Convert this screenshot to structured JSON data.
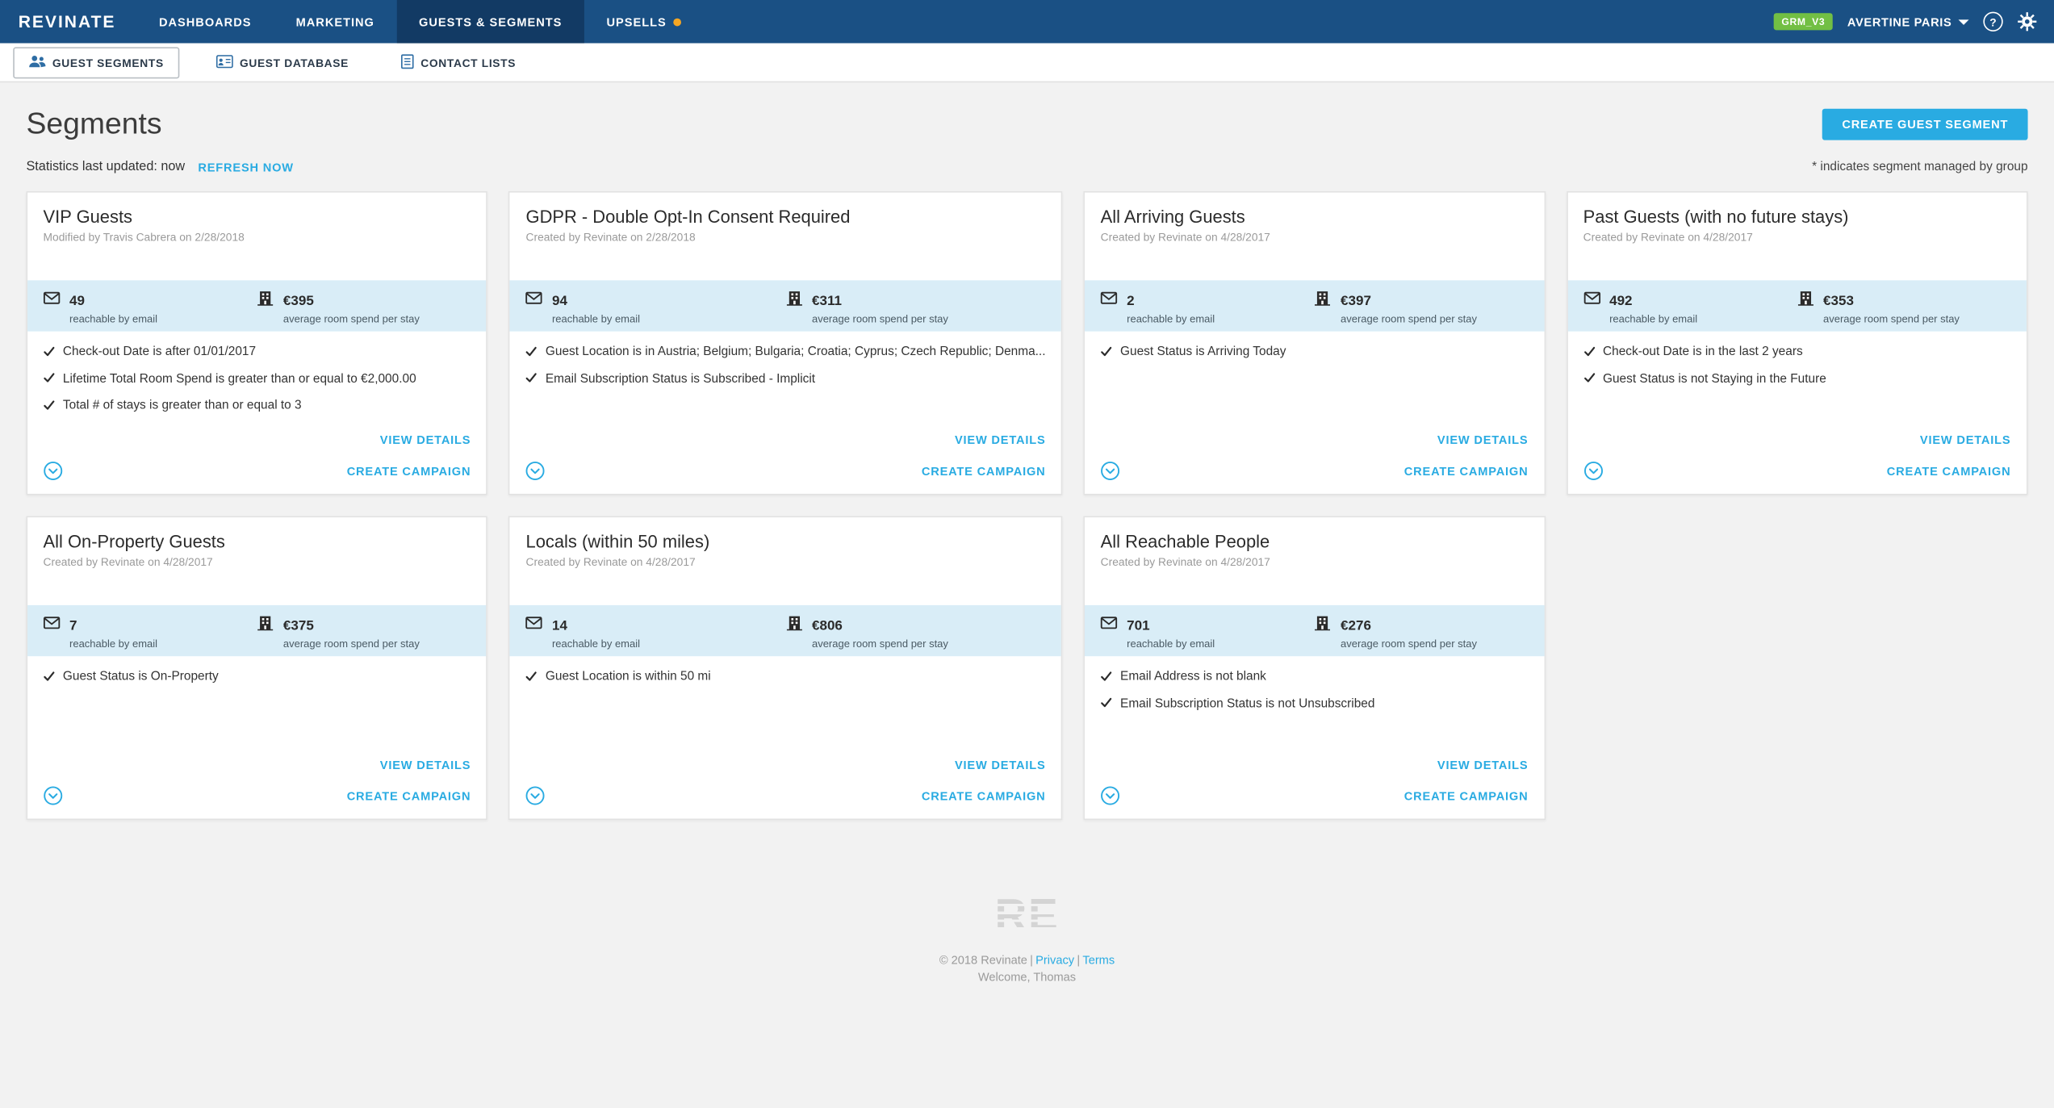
{
  "topnav": {
    "logo": "REVINATE",
    "tabs": [
      {
        "label": "DASHBOARDS",
        "active": false
      },
      {
        "label": "MARKETING",
        "active": false
      },
      {
        "label": "GUESTS & SEGMENTS",
        "active": true
      },
      {
        "label": "UPSELLS",
        "active": false,
        "notification_dot": true
      }
    ],
    "env_badge": "GRM_V3",
    "account_name": "AVERTINE PARIS",
    "help_glyph": "?"
  },
  "subnav": {
    "items": [
      {
        "label": "GUEST SEGMENTS",
        "active": true
      },
      {
        "label": "GUEST DATABASE",
        "active": false
      },
      {
        "label": "CONTACT LISTS",
        "active": false
      }
    ]
  },
  "header": {
    "title": "Segments",
    "create_button": "CREATE GUEST SEGMENT"
  },
  "statusbar": {
    "updated_text": "Statistics last updated: now",
    "refresh_link": "REFRESH NOW",
    "group_note": "* indicates segment managed by group"
  },
  "card_labels": {
    "reachable": "reachable by email",
    "avg_spend": "average room spend per stay",
    "view_details": "VIEW DETAILS",
    "create_campaign": "CREATE CAMPAIGN"
  },
  "cards": [
    {
      "title": "VIP Guests",
      "subtitle": "Modified by Travis Cabrera on 2/28/2018",
      "email_count": "49",
      "avg_spend": "€395",
      "criteria": [
        "Check-out Date is after 01/01/2017",
        "Lifetime Total Room Spend is greater than or equal to €2,000.00",
        "Total # of stays is greater than or equal to 3"
      ]
    },
    {
      "title": "GDPR - Double Opt-In Consent Required",
      "subtitle": "Created by Revinate on 2/28/2018",
      "email_count": "94",
      "avg_spend": "€311",
      "criteria": [
        "Guest Location is in Austria; Belgium; Bulgaria; Croatia; Cyprus; Czech Republic; Denma...",
        "Email Subscription Status is Subscribed - Implicit"
      ]
    },
    {
      "title": "All Arriving Guests",
      "subtitle": "Created by Revinate on 4/28/2017",
      "email_count": "2",
      "avg_spend": "€397",
      "criteria": [
        "Guest Status is Arriving Today"
      ]
    },
    {
      "title": "Past Guests (with no future stays)",
      "subtitle": "Created by Revinate on 4/28/2017",
      "email_count": "492",
      "avg_spend": "€353",
      "criteria": [
        "Check-out Date is in the last 2 years",
        "Guest Status is not Staying in the Future"
      ]
    },
    {
      "title": "All On-Property Guests",
      "subtitle": "Created by Revinate on 4/28/2017",
      "email_count": "7",
      "avg_spend": "€375",
      "criteria": [
        "Guest Status is On-Property"
      ]
    },
    {
      "title": "Locals (within 50 miles)",
      "subtitle": "Created by Revinate on 4/28/2017",
      "email_count": "14",
      "avg_spend": "€806",
      "criteria": [
        "Guest Location is within 50 mi"
      ]
    },
    {
      "title": "All Reachable People",
      "subtitle": "Created by Revinate on 4/28/2017",
      "email_count": "701",
      "avg_spend": "€276",
      "criteria": [
        "Email Address is not blank",
        "Email Subscription Status is not Unsubscribed"
      ]
    }
  ],
  "footer": {
    "logo": "RE",
    "copyright": "© 2018 Revinate",
    "privacy_link": "Privacy",
    "terms_link": "Terms",
    "welcome": "Welcome, Thomas"
  },
  "colors": {
    "navbar": "#1a5084",
    "navbar_active_tab": "#123a64",
    "accent_blue": "#29abe2",
    "stats_band_bg": "#d9edf7",
    "badge_green": "#72bf44",
    "upsells_dot_orange": "#f5a623",
    "page_bg": "#f2f2f2"
  }
}
